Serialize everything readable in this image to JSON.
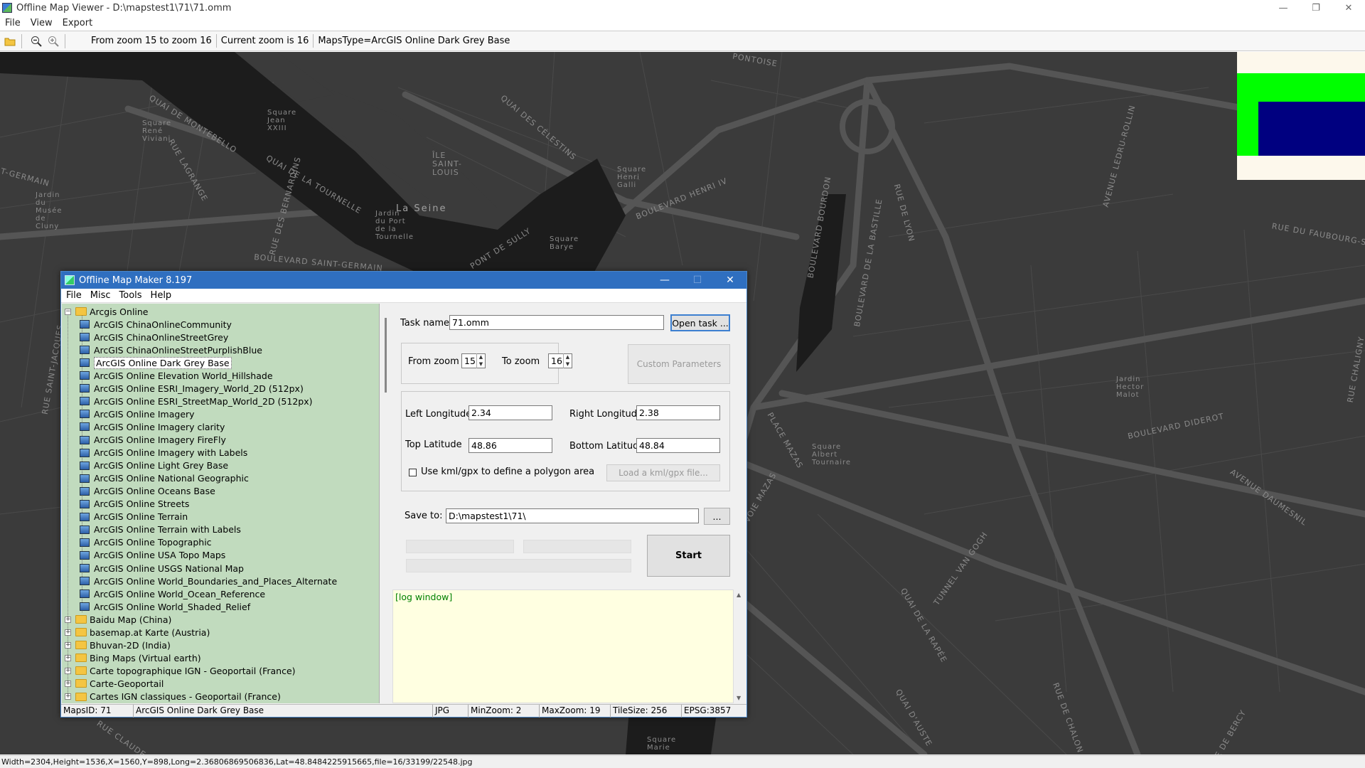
{
  "window": {
    "title": "Offline Map Viewer - D:\\mapstest1\\71\\71.omm",
    "controls": [
      "—",
      "❐",
      "✕"
    ]
  },
  "menu": [
    "File",
    "View",
    "Export"
  ],
  "toolbar": {
    "zoom_range": "From zoom 15 to zoom 16",
    "current_zoom": "Current zoom is 16",
    "maps_type": "MapsType=ArcGIS Online Dark Grey Base"
  },
  "map": {
    "labels": [
      "QUAI DE MONTEBELLO",
      "RUE LAGRANGE",
      "QUAI DE LA TOURNELLE",
      "BOULEVARD SAINT-GERMAIN",
      "RUE DES BERNARDINS",
      "Square René Viviani",
      "Square Jean XXIII",
      "ÎLE SAINT-LOUIS",
      "QUAI DES CÉLESTINS",
      "BOULEVARD HENRI IV",
      "Square Henri Galli",
      "La Seine",
      "Jardin du Port de la Tournelle",
      "PONT DE SULLY",
      "Square Barye",
      "BOULEVARD BOURDON",
      "BOULEVARD DE LA BASTILLE",
      "RUE DE LYON",
      "AVENUE LEDRU-ROLLIN",
      "RUE DU FAUBOURG-S",
      "BOULEVARD DIDEROT",
      "AVENUE DAUMESNIL",
      "Jardin Hector Malot",
      "PLACE MAZAS",
      "VOIE MAZAS",
      "Square Albert Tournaire",
      "QUAI DE LA RAPÉE",
      "TUNNEL VAN GOGH",
      "RUE SAINT-JACQUES",
      "T-GERMAIN",
      "Jardin du Musée de Cluny",
      "RUE CHALIGNY",
      "PONTOISE",
      "RUE CLAUDE",
      "Square Marie",
      "QUAI D'AUSTE",
      "RUE DE CHALON",
      "RUE DE BERCY"
    ]
  },
  "statusbar": "Width=2304,Height=1536,X=1560,Y=898,Long=2.36806869506836,Lat=48.8484225915665,file=16/33199/22548.jpg",
  "dialog": {
    "title": "Offline Map Maker 8.197",
    "menu": [
      "File",
      "Misc",
      "Tools",
      "Help"
    ],
    "tree": {
      "root": "Arcgis Online",
      "children": [
        "ArcGIS ChinaOnlineCommunity",
        "ArcGIS ChinaOnlineStreetGrey",
        "ArcGIS ChinaOnlineStreetPurplishBlue",
        "ArcGIS Online Dark Grey Base",
        "ArcGIS Online Elevation World_Hillshade",
        "ArcGIS Online ESRI_Imagery_World_2D (512px)",
        "ArcGIS Online ESRI_StreetMap_World_2D (512px)",
        "ArcGIS Online Imagery",
        "ArcGIS Online Imagery clarity",
        "ArcGIS Online Imagery FireFly",
        "ArcGIS Online Imagery with Labels",
        "ArcGIS Online Light Grey Base",
        "ArcGIS Online National Geographic",
        "ArcGIS Online Oceans Base",
        "ArcGIS Online Streets",
        "ArcGIS Online Terrain",
        "ArcGIS Online Terrain with Labels",
        "ArcGIS Online Topographic",
        "ArcGIS Online USA Topo Maps",
        "ArcGIS Online USGS National Map",
        "ArcGIS Online World_Boundaries_and_Places_Alternate",
        "ArcGIS Online World_Ocean_Reference",
        "ArcGIS Online World_Shaded_Relief"
      ],
      "selected_index": 3,
      "folders": [
        "Baidu Map (China)",
        "basemap.at Karte (Austria)",
        "Bhuvan-2D (India)",
        "Bing Maps (Virtual earth)",
        "Carte topographique IGN - Geoportail (France)",
        "Carte-Geoportail",
        "Cartes IGN classiques - Geoportail (France)"
      ]
    },
    "task_name_label": "Task name",
    "task_name_value": "71.omm",
    "open_task_label": "Open task ...",
    "from_zoom_label": "From zoom",
    "from_zoom_value": "15",
    "to_zoom_label": "To zoom",
    "to_zoom_value": "16",
    "custom_params_label": "Custom Parameters",
    "left_lon_label": "Left Longitude",
    "left_lon_value": "2.34",
    "right_lon_label": "Right Longitude",
    "right_lon_value": "2.38",
    "top_lat_label": "Top Latitude",
    "top_lat_value": "48.86",
    "bottom_lat_label": "Bottom Latitude",
    "bottom_lat_value": "48.84",
    "kml_checkbox_label": "Use kml/gpx to define a polygon area",
    "load_kml_label": "Load a kml/gpx file...",
    "save_to_label": "Save to:",
    "save_to_value": "D:\\mapstest1\\71\\",
    "browse_label": "...",
    "start_label": "Start",
    "log_text": "[log window]",
    "status": {
      "maps_id": "MapsID: 71",
      "map_name": "ArcGIS Online Dark Grey Base",
      "format": "JPG",
      "min_zoom": "MinZoom: 2",
      "max_zoom": "MaxZoom: 19",
      "tile_size": "TileSize: 256",
      "epsg": "EPSG:3857"
    }
  },
  "colors": {
    "map_bg": "#3b3b3b",
    "river": "#1b1b1b",
    "tree_bg": "#c1dbbe",
    "log_bg": "#ffffe1",
    "dialog_title": "#2f6fc0",
    "overview_outer": "#00ff00",
    "overview_inner": "#000080"
  }
}
